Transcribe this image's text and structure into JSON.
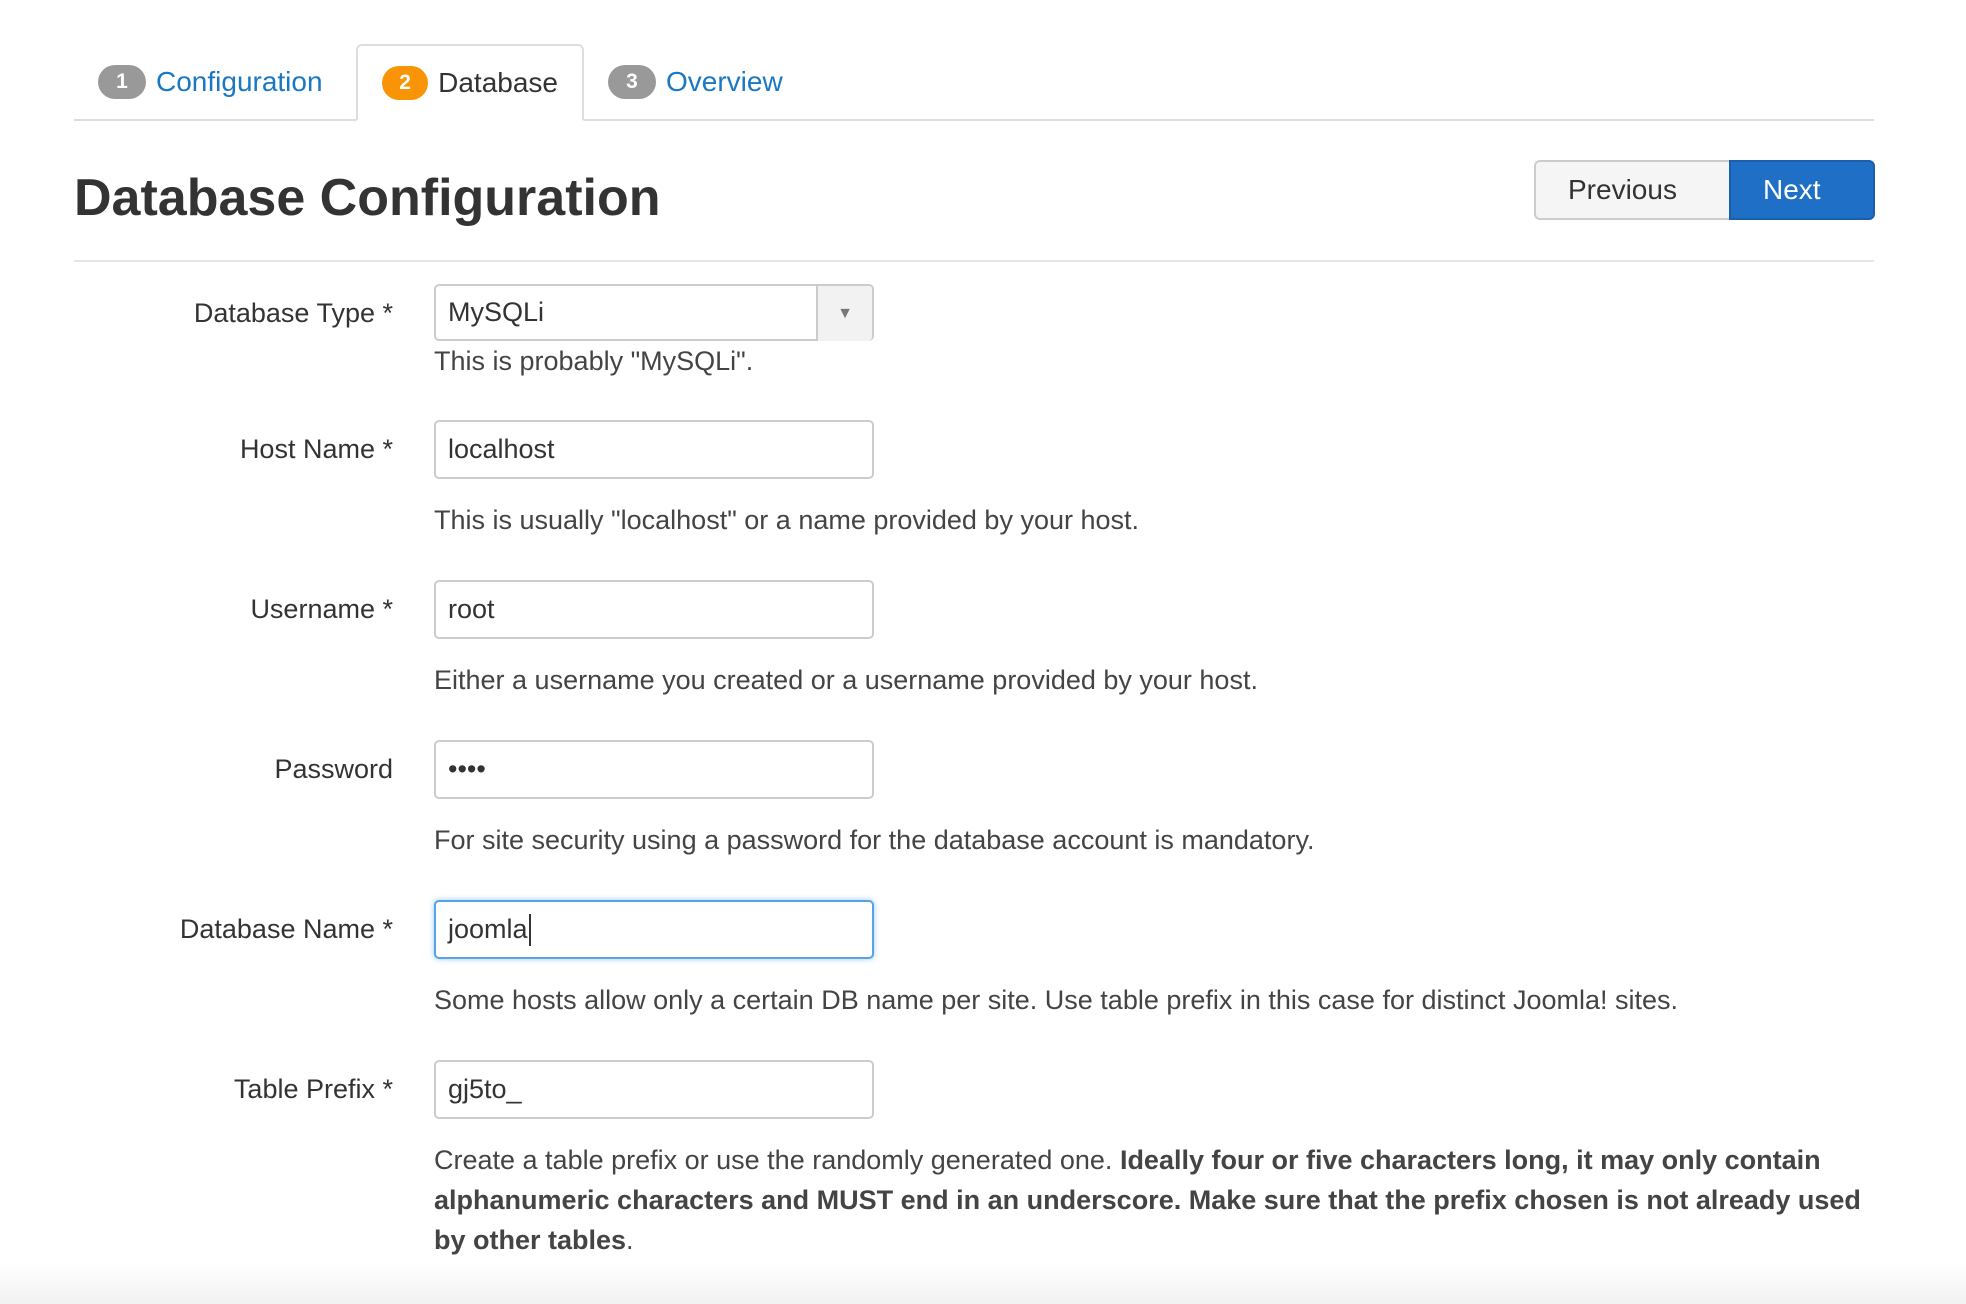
{
  "tabs": [
    {
      "number": "1",
      "label": "Configuration"
    },
    {
      "number": "2",
      "label": "Database"
    },
    {
      "number": "3",
      "label": "Overview"
    }
  ],
  "header": {
    "title": "Database Configuration",
    "previous_label": "Previous",
    "next_label": "Next"
  },
  "form": {
    "db_type": {
      "label": "Database Type *",
      "value": "MySQLi",
      "help": "This is probably \"MySQLi\"."
    },
    "host": {
      "label": "Host Name *",
      "value": "localhost",
      "help": "This is usually \"localhost\" or a name provided by your host."
    },
    "username": {
      "label": "Username *",
      "value": "root",
      "help": "Either a username you created or a username provided by your host."
    },
    "password": {
      "label": "Password",
      "value": "••••",
      "help": "For site security using a password for the database account is mandatory."
    },
    "db_name": {
      "label": "Database Name *",
      "value": "joomla",
      "help": "Some hosts allow only a certain DB name per site. Use table prefix in this case for distinct Joomla! sites."
    },
    "prefix": {
      "label": "Table Prefix *",
      "value": "gj5to_",
      "help_plain": "Create a table prefix or use the randomly generated one.",
      "help_bold": "Ideally four or five characters long, it may only contain alphanumeric characters and MUST end in an underscore. Make sure that the prefix chosen is not already used by other tables",
      "help_end": "."
    }
  },
  "icons": {
    "previous": "arrow-left-icon",
    "next": "arrow-right-icon",
    "select": "caret-down-icon"
  },
  "colors": {
    "active_badge": "#f89406",
    "inactive_badge": "#999999",
    "link": "#1a78c2",
    "primary_button": "#1f6fc6"
  }
}
